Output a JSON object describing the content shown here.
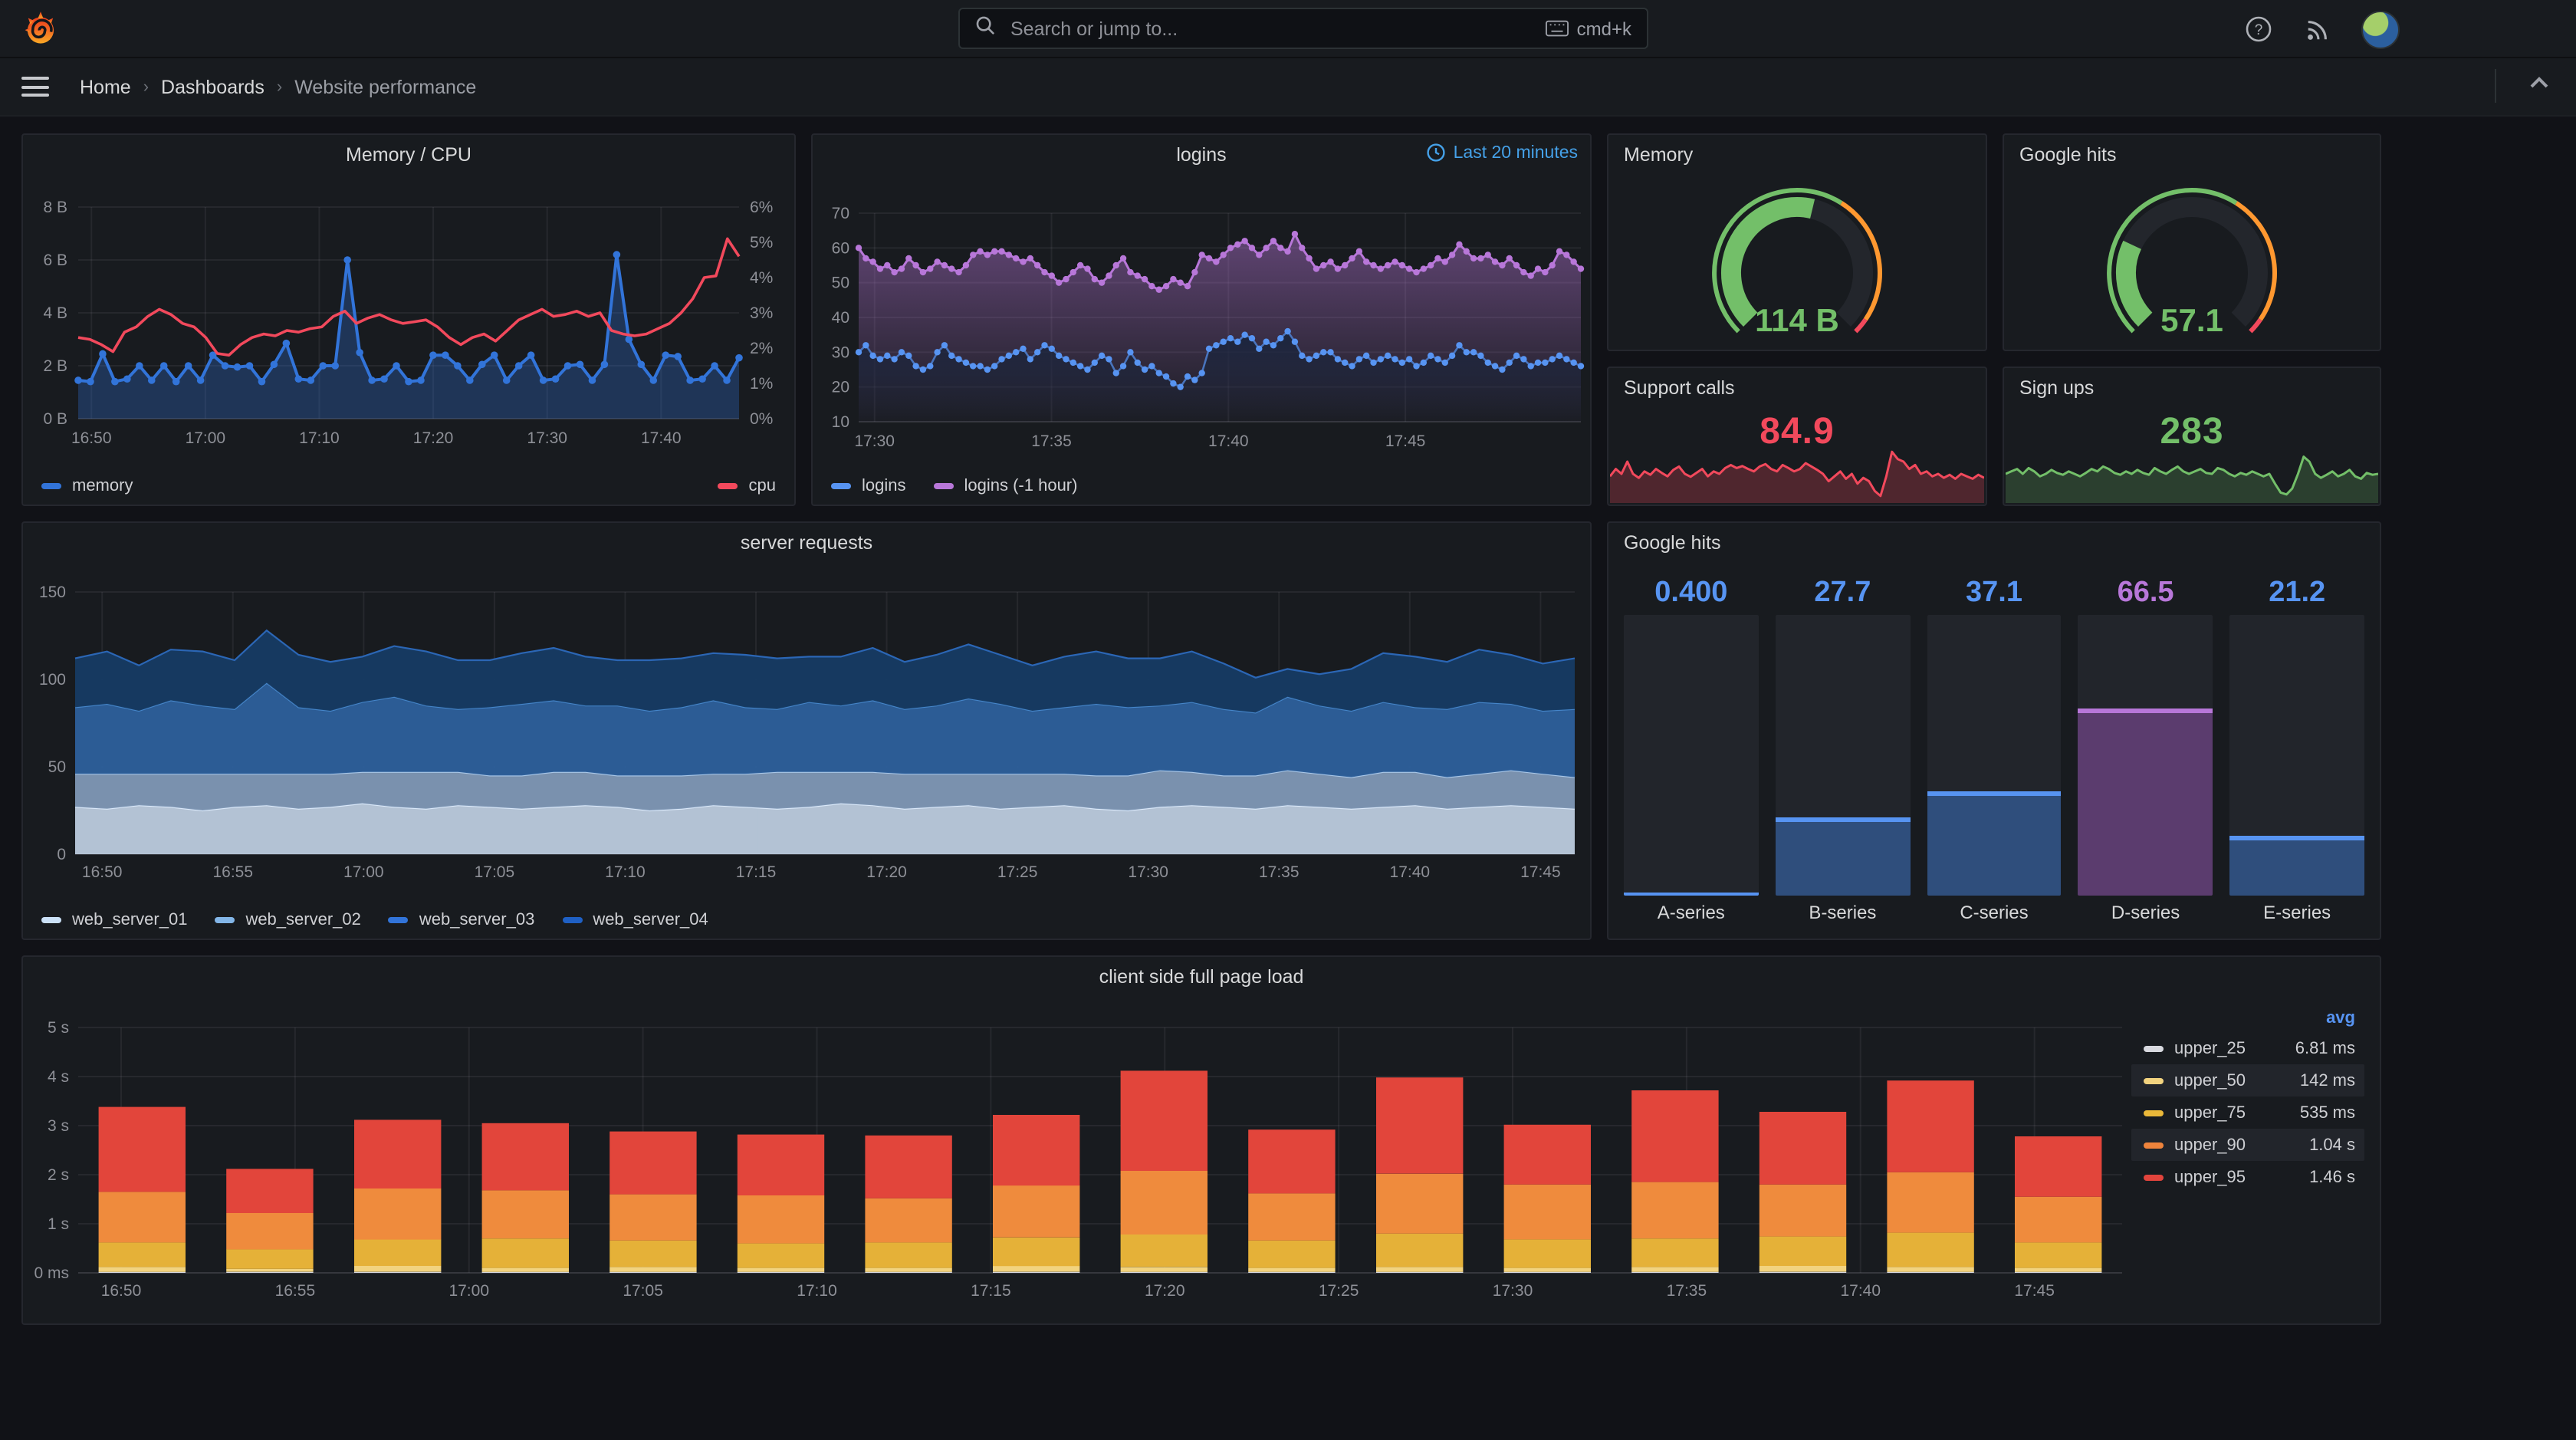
{
  "nav": {
    "search_placeholder": "Search or jump to...",
    "shortcut": "cmd+k"
  },
  "breadcrumb": {
    "items": [
      "Home",
      "Dashboards",
      "Website performance"
    ]
  },
  "colors": {
    "blue": "#5794F2",
    "deep_blue": "#3274D9",
    "purple": "#B877D9",
    "green": "#73BF69",
    "red": "#F2495C",
    "dark_red": "#E2443C",
    "orange": "#FF9830",
    "bar_orange": "#EF843C",
    "gold": "#EAB839",
    "pale_gold": "#f2d37f",
    "white_series": "#d8d9df",
    "panel_bg": "#181b1f",
    "page_bg": "#111217",
    "track": "#22252b",
    "time_badge": "#45a1e8"
  },
  "panels": {
    "mem_cpu": {
      "title": "Memory / CPU",
      "legend": [
        "memory",
        "cpu"
      ]
    },
    "logins": {
      "title": "logins",
      "time_badge": "Last 20 minutes",
      "legend": [
        "logins",
        "logins (-1 hour)"
      ]
    },
    "memory_gauge": {
      "title": "Memory",
      "value": "114 B"
    },
    "google_hits_gauge": {
      "title": "Google hits",
      "value": "57.1"
    },
    "support_calls": {
      "title": "Support calls",
      "value": "84.9"
    },
    "sign_ups": {
      "title": "Sign ups",
      "value": "283"
    },
    "server_requests": {
      "title": "server requests",
      "legend": [
        "web_server_01",
        "web_server_02",
        "web_server_03",
        "web_server_04"
      ]
    },
    "google_hits_bars": {
      "title": "Google hits"
    },
    "client_load": {
      "title": "client side full page load",
      "legend_header": "avg",
      "legend_rows": [
        [
          "upper_25",
          "6.81 ms"
        ],
        [
          "upper_50",
          "142 ms"
        ],
        [
          "upper_75",
          "535 ms"
        ],
        [
          "upper_90",
          "1.04 s"
        ],
        [
          "upper_95",
          "1.46 s"
        ]
      ]
    }
  },
  "chart_data": [
    {
      "id": "mem_cpu",
      "type": "line",
      "x_ticks": {
        "labels": [
          "16:50",
          "17:00",
          "17:10",
          "17:20",
          "17:30",
          "17:40"
        ],
        "start": 0.02,
        "step": 0.1724
      },
      "left_axis": {
        "labels": [
          "8 B",
          "6 B",
          "4 B",
          "2 B",
          "0 B"
        ],
        "min": 0,
        "max": 8
      },
      "right_axis": {
        "labels": [
          "6%",
          "5%",
          "4%",
          "3%",
          "2%",
          "1%",
          "0%"
        ],
        "min": 0,
        "max": 6
      },
      "series": [
        {
          "name": "memory",
          "axis": "left",
          "color": "#3274D9",
          "fill": "rgba(50,116,217,0.3)",
          "dots": true,
          "values": [
            1.45,
            1.4,
            2.45,
            1.4,
            1.5,
            2.0,
            1.45,
            2.0,
            1.4,
            2.0,
            1.45,
            2.4,
            2.0,
            1.95,
            2.0,
            1.4,
            2.05,
            2.85,
            1.5,
            1.45,
            2.0,
            2.0,
            6.0,
            2.5,
            1.45,
            1.5,
            2.0,
            1.4,
            1.45,
            2.4,
            2.4,
            2.0,
            1.45,
            2.05,
            2.4,
            1.45,
            2.0,
            2.4,
            1.45,
            1.5,
            2.0,
            2.05,
            1.45,
            2.05,
            6.2,
            3.0,
            2.05,
            1.45,
            2.4,
            2.35,
            1.45,
            1.5,
            2.0,
            1.45,
            2.3
          ]
        },
        {
          "name": "cpu",
          "axis": "right",
          "color": "#F2495C",
          "dots": false,
          "values": [
            2.3,
            2.25,
            2.1,
            1.9,
            2.45,
            2.6,
            2.9,
            3.1,
            2.95,
            2.7,
            2.6,
            2.3,
            1.85,
            1.8,
            2.1,
            2.3,
            2.4,
            2.35,
            2.5,
            2.45,
            2.55,
            2.6,
            2.9,
            3.05,
            2.7,
            2.85,
            2.95,
            2.8,
            2.7,
            2.75,
            2.8,
            2.6,
            2.3,
            2.1,
            2.3,
            2.4,
            2.2,
            2.5,
            2.8,
            2.95,
            3.1,
            2.9,
            2.95,
            3.05,
            2.9,
            3.0,
            2.5,
            2.4,
            2.35,
            2.4,
            2.55,
            2.7,
            3.0,
            3.4,
            4.0,
            4.05,
            5.1,
            4.6
          ]
        }
      ]
    },
    {
      "id": "logins",
      "type": "line",
      "x_ticks": {
        "labels": [
          "17:30",
          "17:35",
          "17:40",
          "17:45"
        ],
        "start": 0.022,
        "step": 0.245
      },
      "left_axis": {
        "labels": [
          "70",
          "60",
          "50",
          "40",
          "30",
          "20",
          "10"
        ],
        "min": 10,
        "max": 70
      },
      "series": [
        {
          "name": "logins (-1 hour)",
          "color": "#B877D9",
          "dots": true,
          "gradfill": "purple",
          "values": [
            60,
            57,
            56,
            54,
            55,
            53,
            54,
            57,
            55,
            53,
            54,
            56,
            55,
            54,
            53,
            55,
            58,
            59,
            58,
            59,
            59,
            58,
            57,
            56,
            57,
            55,
            53,
            52,
            50,
            51,
            53,
            55,
            54,
            51,
            50,
            52,
            55,
            57,
            53,
            52,
            51,
            49,
            48,
            49,
            51,
            50,
            49,
            53,
            58,
            57,
            56,
            58,
            60,
            61,
            62,
            60,
            58,
            60,
            62,
            60,
            59,
            64,
            60,
            57,
            54,
            55,
            56,
            54,
            55,
            57,
            59,
            56,
            55,
            54,
            55,
            56,
            55,
            54,
            53,
            54,
            55,
            57,
            56,
            58,
            61,
            59,
            57,
            57,
            58,
            56,
            55,
            57,
            55,
            53,
            52,
            54,
            53,
            55,
            59,
            58,
            56,
            54
          ]
        },
        {
          "name": "logins",
          "color": "#5794F2",
          "dots": true,
          "gradfill": "navy",
          "values": [
            30,
            32,
            29,
            28,
            29,
            28,
            30,
            29,
            26,
            25,
            26,
            30,
            32,
            29,
            28,
            27,
            26,
            26,
            25,
            26,
            28,
            29,
            30,
            31,
            28,
            30,
            32,
            31,
            29,
            28,
            27,
            26,
            25,
            27,
            29,
            28,
            24,
            26,
            30,
            27,
            25,
            26,
            24,
            23,
            21,
            20,
            23,
            22,
            24,
            31,
            32,
            33,
            34,
            33,
            35,
            34,
            31,
            33,
            32,
            34,
            36,
            33,
            29,
            28,
            29,
            30,
            30,
            28,
            27,
            26,
            28,
            29,
            27,
            28,
            29,
            28,
            27,
            28,
            26,
            27,
            29,
            28,
            27,
            29,
            32,
            30,
            30,
            29,
            27,
            26,
            25,
            27,
            29,
            28,
            26,
            27,
            27,
            28,
            29,
            28,
            27,
            26
          ]
        }
      ]
    },
    {
      "id": "memory_gauge",
      "type": "gauge",
      "display_value": "114 B",
      "fraction": 0.55,
      "value_color": "#73BF69",
      "thresholds": [
        [
          0,
          0.62,
          "#73BF69"
        ],
        [
          0.62,
          0.96,
          "#FF9830"
        ],
        [
          0.96,
          1,
          "#F2495C"
        ]
      ]
    },
    {
      "id": "google_hits_gauge",
      "type": "gauge",
      "display_value": "57.1",
      "fraction": 0.26,
      "value_color": "#73BF69",
      "thresholds": [
        [
          0,
          0.62,
          "#73BF69"
        ],
        [
          0.62,
          0.96,
          "#FF9830"
        ],
        [
          0.96,
          1,
          "#F2495C"
        ]
      ]
    },
    {
      "id": "support_calls",
      "type": "stat",
      "color": "#F2495C",
      "fill": "rgba(242,73,92,0.25)",
      "values": [
        0.45,
        0.6,
        0.5,
        0.75,
        0.5,
        0.42,
        0.55,
        0.48,
        0.6,
        0.52,
        0.45,
        0.58,
        0.65,
        0.5,
        0.44,
        0.52,
        0.6,
        0.45,
        0.55,
        0.5,
        0.62,
        0.68,
        0.62,
        0.66,
        0.6,
        0.55,
        0.65,
        0.7,
        0.6,
        0.55,
        0.68,
        0.62,
        0.55,
        0.6,
        0.72,
        0.65,
        0.58,
        0.5,
        0.35,
        0.45,
        0.55,
        0.4,
        0.5,
        0.3,
        0.42,
        0.35,
        0.15,
        0.05,
        0.45,
        0.95,
        0.8,
        0.75,
        0.6,
        0.68,
        0.5,
        0.55,
        0.45,
        0.5,
        0.42,
        0.48,
        0.4,
        0.5,
        0.45,
        0.4,
        0.48,
        0.42
      ]
    },
    {
      "id": "sign_ups",
      "type": "stat",
      "color": "#73BF69",
      "fill": "rgba(115,191,105,0.22)",
      "values": [
        0.5,
        0.55,
        0.6,
        0.5,
        0.62,
        0.55,
        0.45,
        0.5,
        0.58,
        0.52,
        0.48,
        0.55,
        0.5,
        0.45,
        0.52,
        0.6,
        0.55,
        0.65,
        0.6,
        0.52,
        0.48,
        0.55,
        0.5,
        0.58,
        0.52,
        0.48,
        0.62,
        0.55,
        0.5,
        0.58,
        0.65,
        0.55,
        0.5,
        0.55,
        0.6,
        0.52,
        0.5,
        0.62,
        0.58,
        0.5,
        0.45,
        0.52,
        0.48,
        0.55,
        0.5,
        0.45,
        0.5,
        0.3,
        0.12,
        0.08,
        0.2,
        0.5,
        0.85,
        0.75,
        0.5,
        0.42,
        0.48,
        0.55,
        0.45,
        0.5,
        0.58,
        0.45,
        0.4,
        0.52,
        0.48,
        0.5
      ]
    },
    {
      "id": "server_requests",
      "type": "stacked_area",
      "x_ticks": {
        "labels": [
          "16:50",
          "16:55",
          "17:00",
          "17:05",
          "17:10",
          "17:15",
          "17:20",
          "17:25",
          "17:30",
          "17:35",
          "17:40",
          "17:45"
        ],
        "start": 0.018,
        "step": 0.0872
      },
      "left_axis": {
        "labels": [
          "150",
          "100",
          "50",
          "0"
        ],
        "min": 0,
        "max": 150
      },
      "series": [
        {
          "name": "web_server_01",
          "fill": "#b9c9dc",
          "stroke": "#dbe9fa",
          "swatch": "#CBE1F7",
          "values": [
            27,
            26,
            28,
            27,
            25,
            27,
            28,
            26,
            27,
            29,
            27,
            26,
            28,
            27,
            26,
            27,
            28,
            27,
            25,
            26,
            28,
            27,
            26,
            27,
            29,
            28,
            26,
            27,
            28,
            26,
            27,
            28,
            26,
            25,
            27,
            28,
            27,
            26,
            28,
            27,
            26,
            27,
            28,
            26,
            27,
            28,
            27,
            26
          ]
        },
        {
          "name": "web_server_02",
          "fill": "#7e96b4",
          "stroke": "#a9c7e8",
          "swatch": "#83B6E8",
          "values": [
            19,
            20,
            18,
            19,
            21,
            19,
            18,
            20,
            19,
            18,
            20,
            21,
            19,
            18,
            19,
            20,
            19,
            18,
            20,
            19,
            18,
            19,
            21,
            20,
            18,
            19,
            20,
            19,
            18,
            20,
            19,
            18,
            19,
            20,
            21,
            19,
            18,
            19,
            20,
            19,
            18,
            20,
            19,
            18,
            19,
            20,
            19,
            18
          ]
        },
        {
          "name": "web_server_03",
          "fill": "#2d5f9a",
          "stroke": "#4585c9",
          "swatch": "#3274D9",
          "values": [
            38,
            40,
            36,
            42,
            39,
            37,
            52,
            38,
            36,
            40,
            43,
            38,
            36,
            39,
            41,
            41,
            38,
            40,
            37,
            39,
            42,
            38,
            36,
            40,
            38,
            41,
            37,
            39,
            43,
            40,
            36,
            38,
            41,
            39,
            37,
            40,
            38,
            36,
            42,
            39,
            38,
            40,
            37,
            39,
            41,
            38,
            36,
            39
          ]
        },
        {
          "name": "web_server_04",
          "fill": "#163a63",
          "stroke": "#2b66b5",
          "swatch": "#1F60C4",
          "values": [
            28,
            30,
            26,
            29,
            31,
            28,
            30,
            30,
            28,
            26,
            29,
            31,
            28,
            27,
            29,
            30,
            28,
            26,
            29,
            28,
            27,
            30,
            29,
            26,
            28,
            30,
            27,
            29,
            31,
            28,
            26,
            29,
            30,
            28,
            27,
            29,
            26,
            20,
            16,
            18,
            24,
            28,
            29,
            27,
            30,
            28,
            27,
            29
          ]
        }
      ]
    },
    {
      "id": "google_hits_bars",
      "type": "bargauge",
      "categories": [
        "A-series",
        "B-series",
        "C-series",
        "D-series",
        "E-series"
      ],
      "display_values": [
        "0.400",
        "27.7",
        "37.1",
        "66.5",
        "21.2"
      ],
      "fractions": [
        0.005,
        0.277,
        0.371,
        0.665,
        0.212
      ],
      "value_colors": [
        "#5794F2",
        "#5794F2",
        "#5794F2",
        "#B877D9",
        "#5794F2"
      ],
      "bar_colors": [
        "#2f4e7c",
        "#2f4e7c",
        "#2f4e7c",
        "#5b3c6e",
        "#2f4e7c"
      ],
      "cap_colors": [
        "#5794F2",
        "#5794F2",
        "#5794F2",
        "#B877D9",
        "#5794F2"
      ]
    },
    {
      "id": "client_load",
      "type": "stacked_bars",
      "x_ticks": {
        "labels": [
          "16:50",
          "16:55",
          "17:00",
          "17:05",
          "17:10",
          "17:15",
          "17:20",
          "17:25",
          "17:30",
          "17:35",
          "17:40",
          "17:45"
        ],
        "start": 0.021,
        "step": 0.0851
      },
      "left_axis": {
        "labels": [
          "5 s",
          "4 s",
          "3 s",
          "2 s",
          "1 s",
          "0 ms"
        ],
        "min": 0,
        "max": 5
      },
      "stack_names": [
        "upper_25",
        "upper_50",
        "upper_75",
        "upper_90",
        "upper_95"
      ],
      "stack_colors": [
        "#d8d9df",
        "#f2d37f",
        "#e5b138",
        "#ef8b3d",
        "#e2453b"
      ],
      "legend_swatches": [
        "#d8d9df",
        "#f2d37f",
        "#EAB839",
        "#EF843C",
        "#E2443C"
      ],
      "bars": [
        [
          0.02,
          0.12,
          0.62,
          1.65,
          3.38
        ],
        [
          0.02,
          0.08,
          0.48,
          1.22,
          2.12
        ],
        [
          0.02,
          0.14,
          0.68,
          1.72,
          3.12
        ],
        [
          0.02,
          0.1,
          0.7,
          1.68,
          3.05
        ],
        [
          0.02,
          0.12,
          0.66,
          1.6,
          2.88
        ],
        [
          0.02,
          0.1,
          0.6,
          1.58,
          2.82
        ],
        [
          0.02,
          0.1,
          0.62,
          1.52,
          2.8
        ],
        [
          0.02,
          0.14,
          0.72,
          1.78,
          3.22
        ],
        [
          0.02,
          0.12,
          0.78,
          2.08,
          4.12
        ],
        [
          0.02,
          0.1,
          0.66,
          1.62,
          2.92
        ],
        [
          0.02,
          0.12,
          0.8,
          2.02,
          3.98
        ],
        [
          0.02,
          0.1,
          0.68,
          1.8,
          3.02
        ],
        [
          0.02,
          0.12,
          0.7,
          1.85,
          3.72
        ],
        [
          0.02,
          0.14,
          0.74,
          1.8,
          3.28
        ],
        [
          0.02,
          0.12,
          0.82,
          2.05,
          3.92
        ],
        [
          0.02,
          0.1,
          0.62,
          1.55,
          2.78
        ]
      ]
    }
  ]
}
